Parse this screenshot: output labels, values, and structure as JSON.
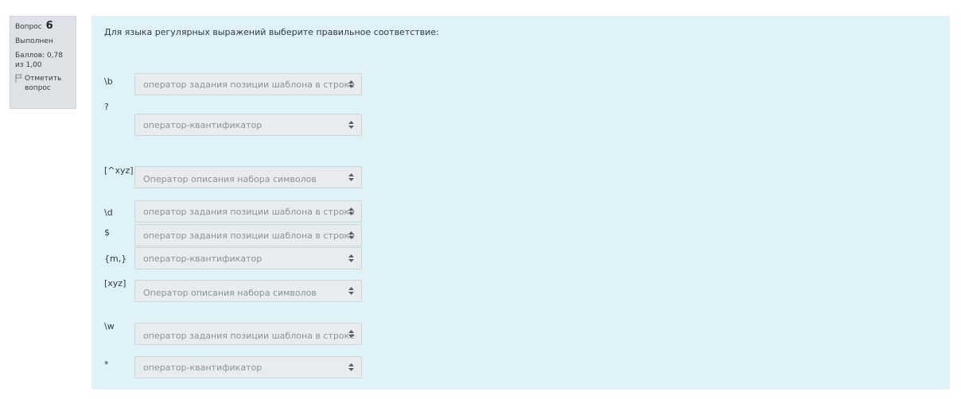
{
  "info": {
    "question_label": "Вопрос",
    "question_number": "6",
    "state": "Выполнен",
    "grade": "Баллов: 0,78 из 1,00",
    "flag_label": "Отметить вопрос"
  },
  "question": {
    "text": "Для языка регулярных выражений выберите правильное соответствие:"
  },
  "rows": [
    {
      "label": "\\b",
      "value": "оператор задания позиции шаблона в строке"
    },
    {
      "label": "?",
      "value": "оператор-квантификатор"
    },
    {
      "label": "[^xyz]",
      "value": "Оператор описания набора символов"
    },
    {
      "label": "\\d",
      "value": "оператор задания позиции шаблона в строке"
    },
    {
      "label": "$",
      "value": "оператор задания позиции шаблона в строке"
    },
    {
      "label": "{m,}",
      "value": "оператор-квантификатор"
    },
    {
      "label": "[xyz]",
      "value": "Оператор описания набора символов"
    },
    {
      "label": "\\w",
      "value": "оператор задания позиции шаблона в строке"
    },
    {
      "label": "*",
      "value": "оператор-квантификатор"
    }
  ],
  "icons": {
    "flag": "flag-icon",
    "select_arrows": "up-down-arrows-icon"
  },
  "colors": {
    "content_bg": "#def2f8",
    "info_bg": "#dee2e6",
    "select_bg": "#e9ecef"
  }
}
